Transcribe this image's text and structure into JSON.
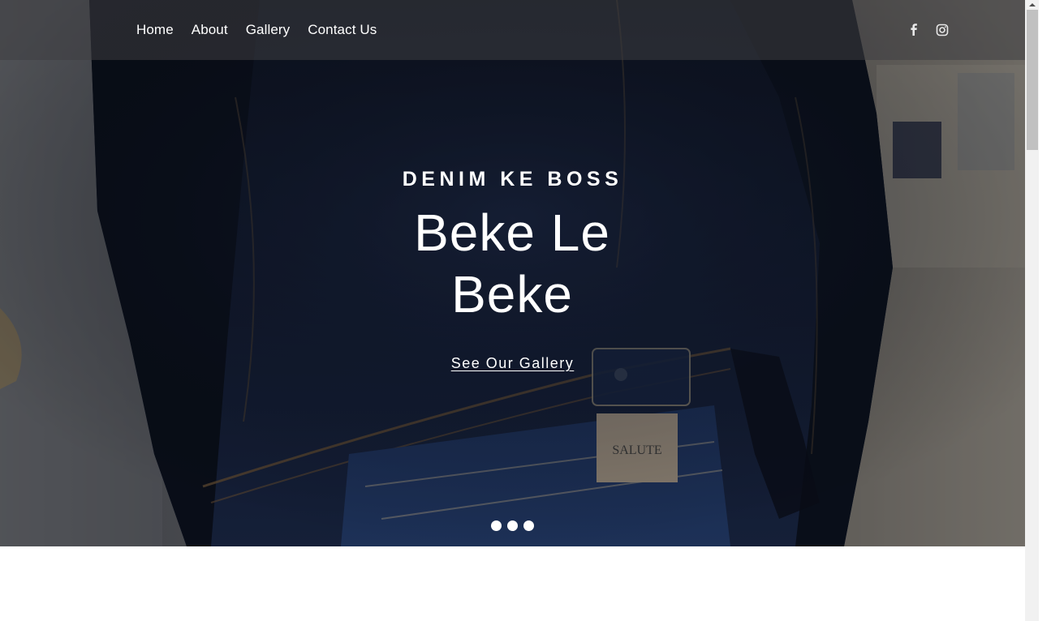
{
  "nav": {
    "links": [
      "Home",
      "About",
      "Gallery",
      "Contact Us"
    ],
    "social": [
      "facebook-icon",
      "instagram-icon"
    ]
  },
  "hero": {
    "eyebrow": "DENIM KE BOSS",
    "headline": "Beke Le Beke",
    "cta_label": "See Our Gallery",
    "slides_count": 3,
    "active_slide": 1,
    "image_label": "SALUTE"
  },
  "colors": {
    "navbar_bg": "#3e3e42",
    "text": "#ffffff",
    "denim": "#1f2f55"
  }
}
